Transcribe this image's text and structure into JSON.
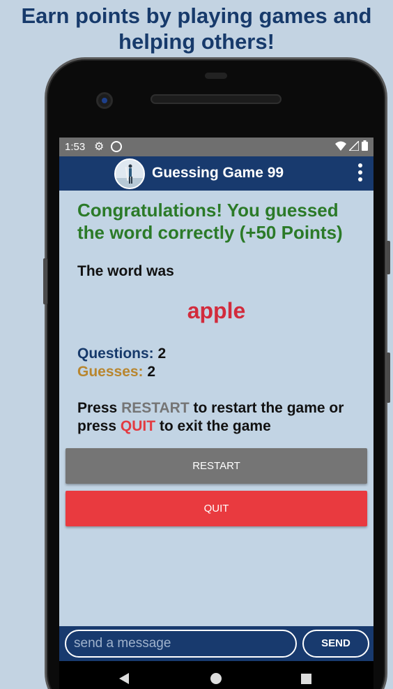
{
  "promo": {
    "headline": "Earn points by playing games and helping others!"
  },
  "status_bar": {
    "time": "1:53"
  },
  "app_bar": {
    "title": "Guessing Game 99"
  },
  "result": {
    "congrats": "Congratulations! You guessed the word correctly (+50 Points)",
    "word_label": "The word was",
    "word": "apple"
  },
  "stats": {
    "questions_label": "Questions:",
    "questions_value": "2",
    "guesses_label": "Guesses:",
    "guesses_value": "2"
  },
  "instructions": {
    "part1": "Press ",
    "restart_word": "RESTART",
    "part2": " to restart the game or press ",
    "quit_word": "QUIT",
    "part3": " to exit the game"
  },
  "buttons": {
    "restart": "RESTART",
    "quit": "QUIT"
  },
  "composer": {
    "placeholder": "send a message",
    "send": "SEND"
  },
  "colors": {
    "background": "#c3d3e2",
    "app_bar": "#183a6e",
    "congrats_green": "#2b7a28",
    "word_red": "#d22b3c",
    "restart_gray": "#757575",
    "quit_red": "#e93a3f"
  },
  "icons": [
    "settings-gear-icon",
    "sync-icon",
    "wifi-icon",
    "signal-icon",
    "battery-icon",
    "more-vert-icon",
    "back-icon",
    "home-icon",
    "recents-icon"
  ]
}
